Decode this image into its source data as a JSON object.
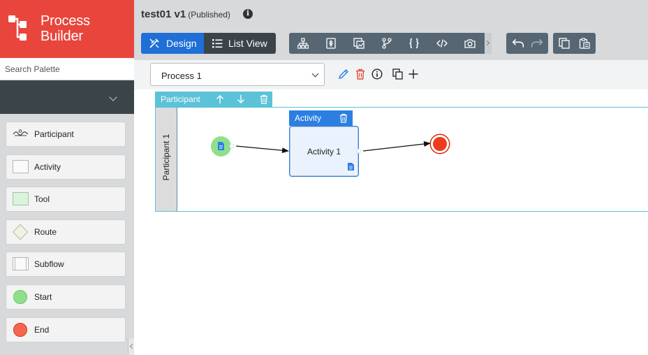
{
  "app": {
    "logo_line1": "Process",
    "logo_line2": "Builder",
    "accent_color": "#e8453c"
  },
  "sidebar": {
    "search_placeholder": "Search Palette",
    "palette": [
      {
        "label": "Participant",
        "icon": "participant-icon"
      },
      {
        "label": "Activity",
        "icon": "activity-icon"
      },
      {
        "label": "Tool",
        "icon": "tool-icon"
      },
      {
        "label": "Route",
        "icon": "route-icon"
      },
      {
        "label": "Subflow",
        "icon": "subflow-icon"
      },
      {
        "label": "Start",
        "icon": "start-icon"
      },
      {
        "label": "End",
        "icon": "end-icon"
      }
    ]
  },
  "header": {
    "title": "test01 v1",
    "status": "(Published)",
    "info_icon": "i",
    "design_label": "Design",
    "listview_label": "List View",
    "primary_color": "#1f6fd6"
  },
  "procbar": {
    "selected_process": "Process 1"
  },
  "canvas": {
    "participant_toolbar_label": "Participant",
    "participant_name": "Participant 1",
    "activity_toolbar_label": "Activity",
    "activity_name": "Activity 1",
    "lane_color": "#5bc2d8",
    "start_color": "#8fe08d",
    "end_color": "#f03a1d"
  }
}
